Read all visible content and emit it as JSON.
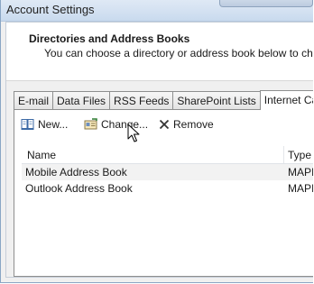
{
  "window": {
    "title": "Account Settings"
  },
  "header": {
    "heading": "Directories and Address Books",
    "description": "You can choose a directory or address book below to char"
  },
  "tabs": [
    {
      "label": "E-mail"
    },
    {
      "label": "Data Files"
    },
    {
      "label": "RSS Feeds"
    },
    {
      "label": "SharePoint Lists"
    },
    {
      "label": "Internet Cal",
      "active": true
    }
  ],
  "toolbar": {
    "new_label": "New...",
    "new_icon": "address-book-icon",
    "change_label": "Change...",
    "change_icon": "change-card-icon",
    "remove_label": "Remove",
    "remove_icon": "x-remove-icon"
  },
  "list": {
    "columns": [
      "Name",
      "Type"
    ],
    "rows": [
      {
        "name": "Mobile Address Book",
        "type": "MAPI",
        "selected": true
      },
      {
        "name": "Outlook Address Book",
        "type": "MAPI",
        "selected": false
      }
    ]
  }
}
